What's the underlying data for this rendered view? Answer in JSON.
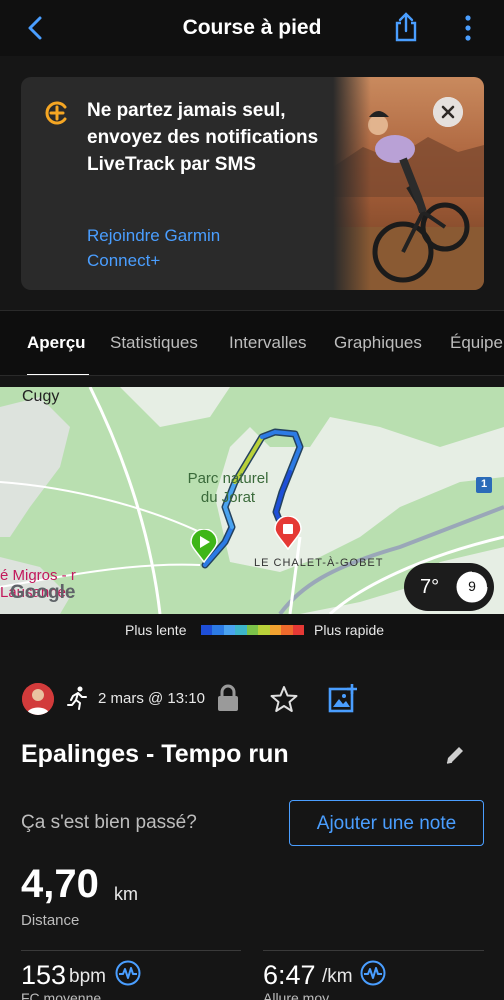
{
  "header": {
    "title": "Course à pied",
    "back_icon": "chevron-left-icon",
    "share_icon": "share-icon",
    "more_icon": "more-vertical-icon"
  },
  "promo": {
    "message": "Ne partez jamais seul, envoyez des notifications LiveTrack par SMS",
    "link": "Rejoindre Garmin Connect+",
    "icon": "livetrack-icon",
    "accent": "#f5a623"
  },
  "tabs": [
    "Aperçu",
    "Statistiques",
    "Intervalles",
    "Graphiques",
    "Équipement"
  ],
  "map": {
    "labels": {
      "town": "Cugy",
      "park": "Parc naturel du Jorat",
      "place": "LE CHALET-À-GOBET",
      "poi": "é Migros - r Lausanne",
      "road": "1",
      "attribution": "Google"
    },
    "weather": {
      "temperature": "7°",
      "wind": "9"
    }
  },
  "legend": {
    "slow": "Plus lente",
    "fast": "Plus rapide",
    "colors": [
      "#1e4fd8",
      "#2c7be5",
      "#4aa3f0",
      "#3db5c9",
      "#7cc34a",
      "#b9d13a",
      "#f2a230",
      "#ee6a2c",
      "#e53935"
    ]
  },
  "activity": {
    "date": "2 mars @ 13:10",
    "name": "Epalinges - Tempo run",
    "question": "Ça s'est bien passé?",
    "add_note": "Ajouter une note"
  },
  "stats": {
    "distance": {
      "value": "4,70",
      "unit": "km",
      "label": "Distance"
    },
    "heart_rate": {
      "value": "153",
      "unit": "bpm",
      "label": "FC moyenne"
    },
    "pace": {
      "value": "6:47",
      "unit": "/km",
      "label": "Allure moy."
    }
  },
  "colors": {
    "accent_blue": "#4a9eff",
    "start_marker": "#3fb618",
    "end_marker": "#e53935"
  }
}
